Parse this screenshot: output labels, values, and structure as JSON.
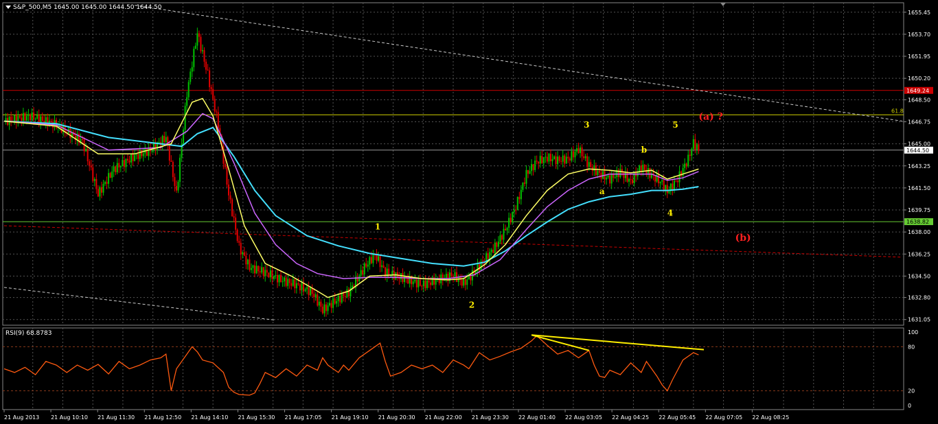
{
  "header": {
    "symbol": "S&P_500,M5",
    "ohlc": "1645.00 1645.00 1644.50 1644.50"
  },
  "rsi_header": "RSI(9) 68.8783",
  "colors": {
    "background": "#000000",
    "grid": "#555555",
    "bull": "#00c000",
    "bear": "#e00000",
    "ma_fast": "#ffff66",
    "ma_mid": "#cc66ff",
    "ma_slow": "#44e0ff",
    "rsi": "#ff5a10",
    "trend_white": "#cccccc",
    "level_red": "#cc0000",
    "level_yellow": "#cccc00",
    "level_green": "#66cc33",
    "label_yellow": "#ffee00",
    "label_red": "#ff2020"
  },
  "chart_data": [
    {
      "type": "candlestick",
      "title": "S&P_500,M5",
      "ylim": [
        1630.6,
        1656.2
      ],
      "y_ticks": [
        "1655.45",
        "1653.70",
        "1651.95",
        "1650.20",
        "1648.50",
        "1646.75",
        "1645.00",
        "1643.25",
        "1641.50",
        "1639.75",
        "1638.00",
        "1636.25",
        "1634.50",
        "1632.80",
        "1631.05"
      ],
      "x_ticks": [
        "21 Aug 2013",
        "21 Aug 10:10",
        "21 Aug 11:30",
        "21 Aug 12:50",
        "21 Aug 14:10",
        "21 Aug 15:30",
        "21 Aug 17:05",
        "21 Aug 19:10",
        "21 Aug 20:30",
        "21 Aug 22:00",
        "21 Aug 23:30",
        "22 Aug 01:40",
        "22 Aug 03:05",
        "22 Aug 04:25",
        "22 Aug 05:45",
        "22 Aug 07:05",
        "22 Aug 08:25"
      ],
      "price_path": [
        [
          0,
          1646.8
        ],
        [
          5,
          1647.2
        ],
        [
          10,
          1646.5
        ],
        [
          15,
          1645.2
        ],
        [
          18,
          1641.0
        ],
        [
          21,
          1643.0
        ],
        [
          25,
          1644.0
        ],
        [
          28,
          1644.5
        ],
        [
          31,
          1645.5
        ],
        [
          33,
          1641.0
        ],
        [
          35,
          1649.0
        ],
        [
          37,
          1653.8
        ],
        [
          39,
          1650.5
        ],
        [
          41,
          1646.5
        ],
        [
          43,
          1641.0
        ],
        [
          45,
          1636.8
        ],
        [
          47,
          1635.2
        ],
        [
          50,
          1634.8
        ],
        [
          53,
          1634.2
        ],
        [
          56,
          1633.8
        ],
        [
          59,
          1633.2
        ],
        [
          61,
          1631.8
        ],
        [
          63,
          1632.4
        ],
        [
          66,
          1633.2
        ],
        [
          69,
          1635.2
        ],
        [
          71,
          1636.2
        ],
        [
          73,
          1634.8
        ],
        [
          76,
          1634.4
        ],
        [
          80,
          1633.8
        ],
        [
          83,
          1634.2
        ],
        [
          86,
          1634.6
        ],
        [
          88,
          1633.9
        ],
        [
          90,
          1634.8
        ],
        [
          92,
          1635.8
        ],
        [
          94,
          1636.8
        ],
        [
          96,
          1638.2
        ],
        [
          98,
          1640.0
        ],
        [
          100,
          1642.6
        ],
        [
          102,
          1643.6
        ],
        [
          104,
          1643.9
        ],
        [
          106,
          1643.7
        ],
        [
          108,
          1643.8
        ],
        [
          110,
          1644.6
        ],
        [
          112,
          1643.3
        ],
        [
          114,
          1642.6
        ],
        [
          116,
          1642.2
        ],
        [
          118,
          1642.8
        ],
        [
          120,
          1642.0
        ],
        [
          122,
          1643.2
        ],
        [
          124,
          1642.5
        ],
        [
          126,
          1641.9
        ],
        [
          127,
          1641.2
        ],
        [
          129,
          1642.2
        ],
        [
          131,
          1643.8
        ],
        [
          132,
          1645.1
        ],
        [
          133,
          1644.5
        ]
      ],
      "ma_fast": [
        [
          0,
          1646.8
        ],
        [
          10,
          1646.4
        ],
        [
          18,
          1644.2
        ],
        [
          25,
          1644.2
        ],
        [
          32,
          1645.0
        ],
        [
          36,
          1648.3
        ],
        [
          38,
          1648.6
        ],
        [
          40,
          1647.2
        ],
        [
          43,
          1643.0
        ],
        [
          46,
          1638.5
        ],
        [
          50,
          1635.5
        ],
        [
          55,
          1634.5
        ],
        [
          60,
          1633.3
        ],
        [
          62,
          1632.8
        ],
        [
          66,
          1633.3
        ],
        [
          70,
          1634.5
        ],
        [
          75,
          1634.6
        ],
        [
          80,
          1634.3
        ],
        [
          85,
          1634.2
        ],
        [
          88,
          1634.3
        ],
        [
          92,
          1635.4
        ],
        [
          96,
          1637.0
        ],
        [
          100,
          1639.3
        ],
        [
          104,
          1641.3
        ],
        [
          108,
          1642.6
        ],
        [
          112,
          1643.0
        ],
        [
          116,
          1642.9
        ],
        [
          120,
          1642.7
        ],
        [
          124,
          1642.9
        ],
        [
          127,
          1642.2
        ],
        [
          130,
          1642.6
        ],
        [
          133,
          1643.0
        ]
      ],
      "ma_mid": [
        [
          0,
          1646.8
        ],
        [
          10,
          1646.5
        ],
        [
          20,
          1644.5
        ],
        [
          30,
          1644.7
        ],
        [
          35,
          1646.0
        ],
        [
          38,
          1647.4
        ],
        [
          40,
          1647.0
        ],
        [
          44,
          1643.5
        ],
        [
          48,
          1639.5
        ],
        [
          52,
          1637.0
        ],
        [
          56,
          1635.5
        ],
        [
          60,
          1634.7
        ],
        [
          65,
          1634.3
        ],
        [
          70,
          1634.4
        ],
        [
          75,
          1634.4
        ],
        [
          80,
          1634.3
        ],
        [
          85,
          1634.3
        ],
        [
          90,
          1634.6
        ],
        [
          95,
          1635.8
        ],
        [
          100,
          1638.2
        ],
        [
          104,
          1640.0
        ],
        [
          108,
          1641.3
        ],
        [
          112,
          1642.2
        ],
        [
          116,
          1642.6
        ],
        [
          120,
          1642.6
        ],
        [
          124,
          1642.6
        ],
        [
          127,
          1642.1
        ],
        [
          130,
          1642.3
        ],
        [
          133,
          1642.8
        ]
      ],
      "ma_slow": [
        [
          0,
          1646.8
        ],
        [
          10,
          1646.6
        ],
        [
          20,
          1645.5
        ],
        [
          30,
          1645.0
        ],
        [
          34,
          1644.8
        ],
        [
          37,
          1645.8
        ],
        [
          40,
          1646.3
        ],
        [
          44,
          1644.0
        ],
        [
          48,
          1641.3
        ],
        [
          52,
          1639.3
        ],
        [
          58,
          1637.7
        ],
        [
          64,
          1636.9
        ],
        [
          70,
          1636.3
        ],
        [
          76,
          1635.9
        ],
        [
          82,
          1635.5
        ],
        [
          88,
          1635.3
        ],
        [
          92,
          1635.6
        ],
        [
          96,
          1636.5
        ],
        [
          100,
          1637.7
        ],
        [
          104,
          1638.8
        ],
        [
          108,
          1639.8
        ],
        [
          112,
          1640.4
        ],
        [
          116,
          1640.8
        ],
        [
          120,
          1641.0
        ],
        [
          124,
          1641.3
        ],
        [
          127,
          1641.3
        ],
        [
          130,
          1641.4
        ],
        [
          133,
          1641.6
        ]
      ],
      "levels": [
        {
          "name": "red",
          "value": 1649.24,
          "label": "1649.24"
        },
        {
          "name": "yellow",
          "value": 1647.3,
          "label": "61.8"
        },
        {
          "name": "green",
          "value": 1638.82,
          "label": "1638.82"
        },
        {
          "name": "current",
          "value": 1644.5,
          "label": "1644.50"
        }
      ],
      "trendlines": [
        {
          "name": "upper",
          "from": [
            25,
            1656.0
          ],
          "to": [
            172,
            1646.8
          ]
        },
        {
          "name": "lower",
          "from": [
            0,
            1633.6
          ],
          "to": [
            52,
            1631.0
          ]
        },
        {
          "name": "red-dashed",
          "from": [
            0,
            1638.5
          ],
          "to": [
            172,
            1636.0
          ]
        }
      ],
      "wave_labels": [
        {
          "text": "1",
          "x": 71,
          "y": 1638.2,
          "color": "yellow"
        },
        {
          "text": "2",
          "x": 89,
          "y": 1632.0,
          "color": "yellow"
        },
        {
          "text": "3",
          "x": 111,
          "y": 1646.3,
          "color": "yellow"
        },
        {
          "text": "a",
          "x": 114,
          "y": 1641.0,
          "color": "yellow"
        },
        {
          "text": "b",
          "x": 122,
          "y": 1644.3,
          "color": "yellow"
        },
        {
          "text": "4",
          "x": 127,
          "y": 1639.3,
          "color": "yellow"
        },
        {
          "text": "5",
          "x": 128,
          "y": 1646.3,
          "color": "yellow"
        },
        {
          "text": "(a)  ?",
          "x": 133,
          "y": 1646.9,
          "color": "red"
        },
        {
          "text": "(b)",
          "x": 140,
          "y": 1637.3,
          "color": "red"
        }
      ],
      "x_count": 172
    },
    {
      "type": "line",
      "title": "RSI(9) 68.8783",
      "ylim": [
        0,
        100
      ],
      "y_ticks": [
        "100",
        "80",
        "20",
        "0"
      ],
      "values": [
        [
          0,
          50
        ],
        [
          2,
          45
        ],
        [
          4,
          52
        ],
        [
          6,
          42
        ],
        [
          8,
          60
        ],
        [
          10,
          55
        ],
        [
          12,
          45
        ],
        [
          14,
          55
        ],
        [
          16,
          48
        ],
        [
          18,
          56
        ],
        [
          20,
          43
        ],
        [
          22,
          60
        ],
        [
          24,
          50
        ],
        [
          26,
          55
        ],
        [
          28,
          62
        ],
        [
          30,
          65
        ],
        [
          31,
          70
        ],
        [
          32,
          20
        ],
        [
          33,
          50
        ],
        [
          35,
          70
        ],
        [
          36,
          80
        ],
        [
          37,
          73
        ],
        [
          38,
          62
        ],
        [
          40,
          58
        ],
        [
          42,
          45
        ],
        [
          43,
          25
        ],
        [
          44,
          18
        ],
        [
          45,
          15
        ],
        [
          47,
          14
        ],
        [
          48,
          17
        ],
        [
          49,
          30
        ],
        [
          50,
          45
        ],
        [
          52,
          38
        ],
        [
          54,
          50
        ],
        [
          56,
          40
        ],
        [
          58,
          55
        ],
        [
          60,
          48
        ],
        [
          61,
          65
        ],
        [
          62,
          55
        ],
        [
          64,
          45
        ],
        [
          65,
          55
        ],
        [
          66,
          48
        ],
        [
          68,
          65
        ],
        [
          70,
          75
        ],
        [
          72,
          85
        ],
        [
          73,
          60
        ],
        [
          74,
          40
        ],
        [
          76,
          45
        ],
        [
          78,
          55
        ],
        [
          80,
          50
        ],
        [
          82,
          55
        ],
        [
          84,
          45
        ],
        [
          86,
          62
        ],
        [
          88,
          55
        ],
        [
          89,
          50
        ],
        [
          91,
          72
        ],
        [
          93,
          62
        ],
        [
          95,
          67
        ],
        [
          97,
          73
        ],
        [
          99,
          78
        ],
        [
          101,
          88
        ],
        [
          102,
          95
        ],
        [
          104,
          82
        ],
        [
          106,
          70
        ],
        [
          108,
          75
        ],
        [
          110,
          65
        ],
        [
          112,
          75
        ],
        [
          113,
          55
        ],
        [
          114,
          40
        ],
        [
          115,
          38
        ],
        [
          116,
          48
        ],
        [
          118,
          42
        ],
        [
          120,
          58
        ],
        [
          122,
          45
        ],
        [
          123,
          60
        ],
        [
          125,
          40
        ],
        [
          126,
          28
        ],
        [
          127,
          20
        ],
        [
          128,
          35
        ],
        [
          130,
          62
        ],
        [
          132,
          72
        ],
        [
          133,
          69
        ]
      ],
      "trendlines": [
        {
          "from": [
            101,
            96
          ],
          "to": [
            112,
            75
          ]
        },
        {
          "from": [
            101,
            96
          ],
          "to": [
            134,
            76
          ]
        }
      ]
    }
  ]
}
